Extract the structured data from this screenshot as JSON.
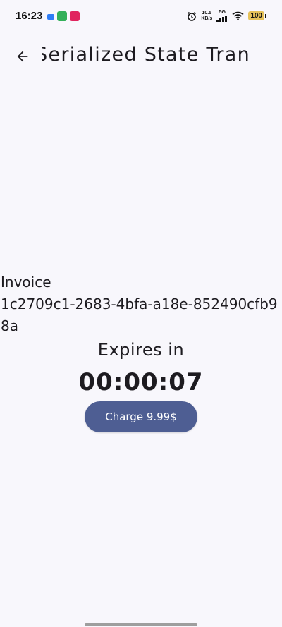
{
  "status_bar": {
    "time": "16:23",
    "net_speed_value": "10.5",
    "net_speed_unit": "KB/s",
    "network_type": "5G",
    "battery_level": "100",
    "icons": [
      "message-notification-icon",
      "game-notification-icon",
      "app-notification-icon",
      "alarm-icon",
      "signal-icon",
      "wifi-icon",
      "battery-icon"
    ]
  },
  "app_bar": {
    "back_icon": "arrow-back-icon",
    "title": "Serialized State Tran"
  },
  "invoice": {
    "label": "Invoice",
    "id": "1c2709c1-2683-4bfa-a18e-852490cfb98a"
  },
  "timer": {
    "label": "Expires in",
    "value": "00:00:07"
  },
  "actions": {
    "charge_label": "Charge 9.99$"
  },
  "colors": {
    "background": "#f8f7fc",
    "primary_button": "#4e5e93",
    "text": "#1d1b20"
  }
}
